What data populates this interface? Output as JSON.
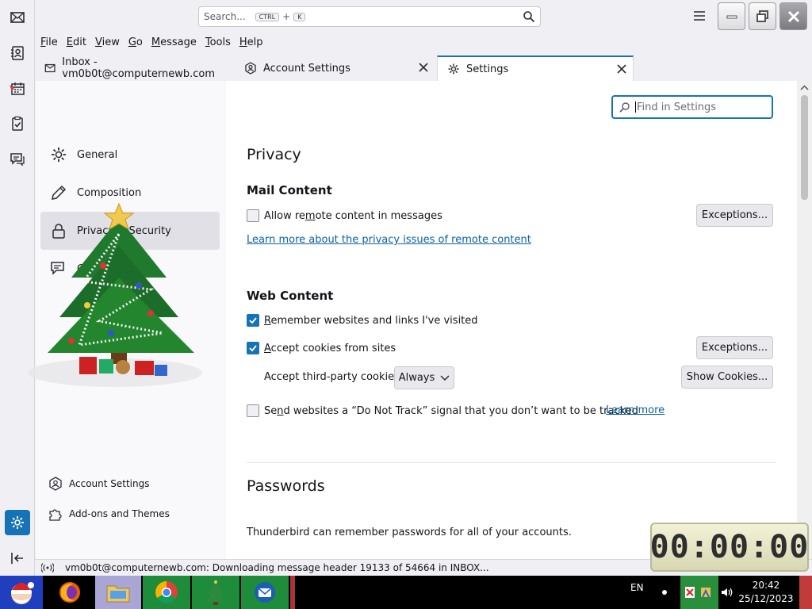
{
  "titlebar": {
    "search_placeholder": "Search...",
    "search_shortcut_mod": "CTRL",
    "search_shortcut_plus": "+",
    "search_shortcut_key": "K"
  },
  "menu": [
    {
      "label": "File",
      "u": "F",
      "rest": "ile"
    },
    {
      "label": "Edit",
      "u": "E",
      "rest": "dit"
    },
    {
      "label": "View",
      "u": "V",
      "rest": "iew"
    },
    {
      "label": "Go",
      "u": "G",
      "rest": "o"
    },
    {
      "label": "Message",
      "u": "M",
      "rest": "essage"
    },
    {
      "label": "Tools",
      "u": "T",
      "rest": "ools"
    },
    {
      "label": "Help",
      "u": "H",
      "rest": "elp"
    }
  ],
  "tabs": [
    {
      "label": "Inbox - vm0b0t@computernewb.com"
    },
    {
      "label": "Account Settings"
    },
    {
      "label": "Settings"
    }
  ],
  "categories": {
    "general": "General",
    "composition": "Composition",
    "privacy": "Privacy & Security",
    "chat": "Chat",
    "account_settings": "Account Settings",
    "addons": "Add-ons and Themes"
  },
  "find_placeholder": "Find in Settings",
  "privacy": {
    "heading": "Privacy",
    "mail_content": {
      "heading": "Mail Content",
      "allow_remote_pre": "Allow re",
      "allow_remote_u": "m",
      "allow_remote_post": "ote content in messages",
      "allow_remote_checked": false,
      "exceptions_label": "Exceptions...",
      "learn_more_link": "Learn more about the privacy issues of remote content"
    },
    "web_content": {
      "heading": "Web Content",
      "remember_u": "R",
      "remember_rest": "emember websites and links I've visited",
      "remember_checked": true,
      "cookies_u": "A",
      "cookies_rest": "ccept cookies from sites",
      "cookies_checked": true,
      "exceptions_label": "Exceptions...",
      "third_party_label": "Accept third-party cookies:",
      "third_party_value": "Always",
      "show_cookies_label": "Show Cookies...",
      "dnt_pre": "Se",
      "dnt_u": "n",
      "dnt_post": "d websites a “Do Not Track” signal that you don’t want to be tracked",
      "dnt_checked": false,
      "dnt_learn_more": "Learn more"
    },
    "passwords": {
      "heading": "Passwords",
      "description": "Thunderbird can remember passwords for all of your accounts."
    }
  },
  "status": {
    "text": "vm0b0t@computernewb.com: Downloading message header 19133 of 54664 in INBOX..."
  },
  "timer": "00:00:00",
  "taskbar": {
    "language": "EN",
    "time": "20:42",
    "date": "25/12/2023"
  },
  "colors": {
    "accent": "#1673b6",
    "link": "#0b61a4"
  }
}
